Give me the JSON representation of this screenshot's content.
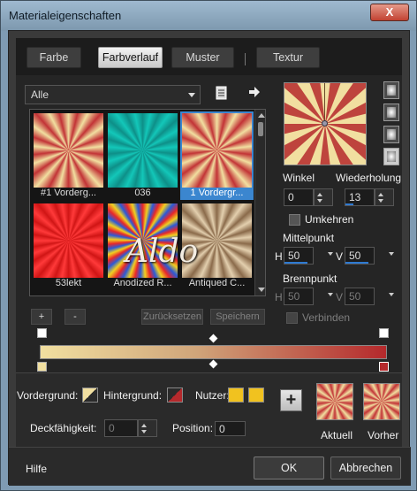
{
  "window": {
    "title": "Materialeigenschaften",
    "close_label": "X"
  },
  "tabs": [
    {
      "label": "Farbe",
      "active": false
    },
    {
      "label": "Farbverlauf",
      "active": true
    },
    {
      "label": "Muster",
      "active": false
    },
    {
      "label": "Textur",
      "active": false
    }
  ],
  "filter": {
    "value": "Alle"
  },
  "gallery": {
    "items": [
      {
        "label": "#1 Vorderg...",
        "selected": false
      },
      {
        "label": "036",
        "selected": false
      },
      {
        "label": "1 Vordergr...",
        "selected": true
      },
      {
        "label": "53lekt",
        "selected": false
      },
      {
        "label": "Anodized R...",
        "selected": false
      },
      {
        "label": "Antiqued C...",
        "selected": false
      }
    ],
    "watermark": "Aldo"
  },
  "gallery_buttons": {
    "add": "+",
    "remove": "-",
    "reset": "Zurücksetzen",
    "save": "Speichern"
  },
  "gradient": {
    "angle_label": "Winkel",
    "angle_value": "0",
    "repeat_label": "Wiederholung",
    "repeat_value": "13",
    "reverse_label": "Umkehren",
    "center_label": "Mittelpunkt",
    "center_h_label": "H",
    "center_h": "50",
    "center_v_label": "V",
    "center_v": "50",
    "focal_label": "Brennpunkt",
    "focal_h_label": "H",
    "focal_h": "50",
    "focal_v_label": "V",
    "focal_v": "50",
    "link_label": "Verbinden",
    "colors": {
      "light": "#f1dfa0",
      "dark": "#b5292c"
    }
  },
  "colors": {
    "foreground_label": "Vordergrund:",
    "background_label": "Hintergrund:",
    "user_label": "Nutzer:",
    "user_color_1": "#f1c21f",
    "user_color_2": "#f1c21f",
    "opacity_label": "Deckfähigkeit:",
    "opacity_value": "0",
    "position_label": "Position:",
    "position_value": "0"
  },
  "preview": {
    "current_label": "Aktuell",
    "previous_label": "Vorher",
    "add_label": "+"
  },
  "footer": {
    "help": "Hilfe",
    "ok": "OK",
    "cancel": "Abbrechen"
  }
}
